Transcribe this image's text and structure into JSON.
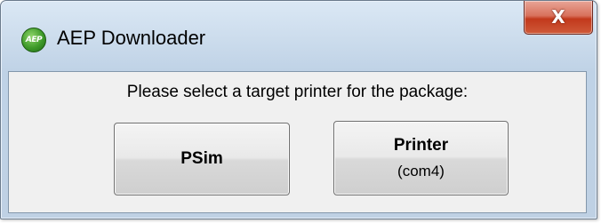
{
  "window": {
    "title": "AEP Downloader",
    "icon_text": "AEP",
    "close_glyph": "X"
  },
  "dialog": {
    "prompt": "Please select a target printer for the package:",
    "buttons": [
      {
        "label": "PSim",
        "sublabel": ""
      },
      {
        "label": "Printer",
        "sublabel": "(com4)"
      }
    ]
  },
  "colors": {
    "titlebar": "#cddded",
    "close_button": "#c2391c",
    "client_background": "#f0f0f0"
  }
}
